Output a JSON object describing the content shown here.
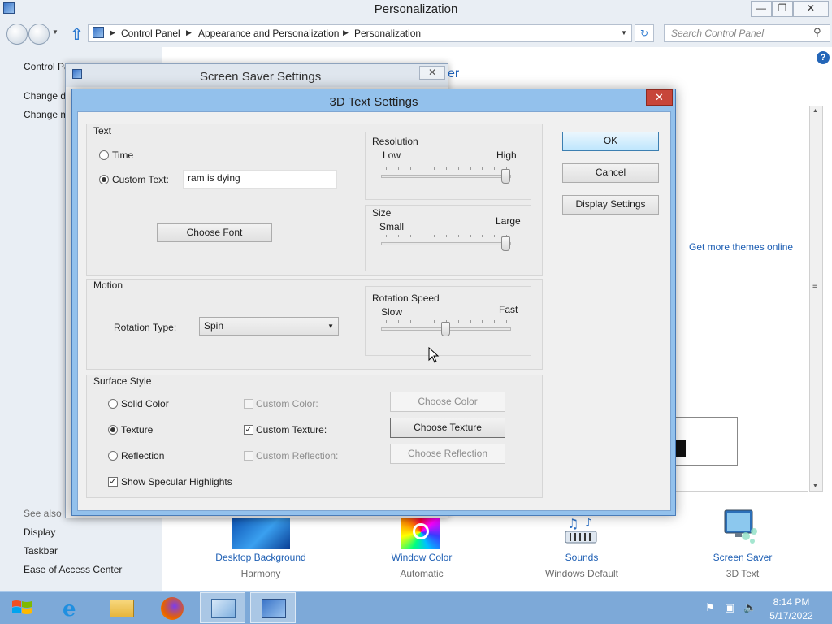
{
  "window": {
    "title": "Personalization",
    "min_label": "—",
    "restore_label": "❐",
    "close_label": "✕"
  },
  "address_bar": {
    "crumbs": [
      "Control Panel",
      "Appearance and Personalization",
      "Personalization"
    ],
    "search_placeholder": "Search Control Panel"
  },
  "left_pane": {
    "header": "Control Pa",
    "links": [
      "Change d",
      "Change m"
    ],
    "see_also_title": "See also",
    "see_also": [
      "Display",
      "Taskbar",
      "Ease of Access Center"
    ]
  },
  "main": {
    "header_fragment": "er",
    "get_more_link": "Get more themes online",
    "tiles": [
      {
        "label": "Desktop Background",
        "sub": "Harmony"
      },
      {
        "label": "Window Color",
        "sub": "Automatic"
      },
      {
        "label": "Sounds",
        "sub": "Windows Default"
      },
      {
        "label": "Screen Saver",
        "sub": "3D Text"
      }
    ]
  },
  "screen_saver_dialog": {
    "title": "Screen Saver Settings",
    "close_label": "✕"
  },
  "text3d_dialog": {
    "title": "3D Text Settings",
    "close_label": "✕",
    "text_group": {
      "title": "Text",
      "time_label": "Time",
      "custom_text_label": "Custom Text:",
      "custom_text_value": "ram is dying",
      "choose_font": "Choose Font"
    },
    "resolution": {
      "title": "Resolution",
      "low": "Low",
      "high": "High",
      "value": 1.0
    },
    "size": {
      "title": "Size",
      "small": "Small",
      "large": "Large",
      "value": 1.0
    },
    "motion": {
      "title": "Motion",
      "rotation_type_label": "Rotation Type:",
      "rotation_type_value": "Spin"
    },
    "rotation_speed": {
      "title": "Rotation Speed",
      "slow": "Slow",
      "fast": "Fast",
      "value": 0.5
    },
    "surface": {
      "title": "Surface Style",
      "solid_color": "Solid Color",
      "texture": "Texture",
      "reflection": "Reflection",
      "custom_color": "Custom Color:",
      "custom_texture": "Custom Texture:",
      "custom_reflection": "Custom Reflection:",
      "choose_color": "Choose Color",
      "choose_texture": "Choose Texture",
      "choose_reflection": "Choose Reflection",
      "specular": "Show Specular Highlights"
    },
    "ok": "OK",
    "cancel": "Cancel",
    "display_settings": "Display Settings"
  },
  "taskbar": {
    "time": "8:14 PM",
    "date": "5/17/2022"
  }
}
